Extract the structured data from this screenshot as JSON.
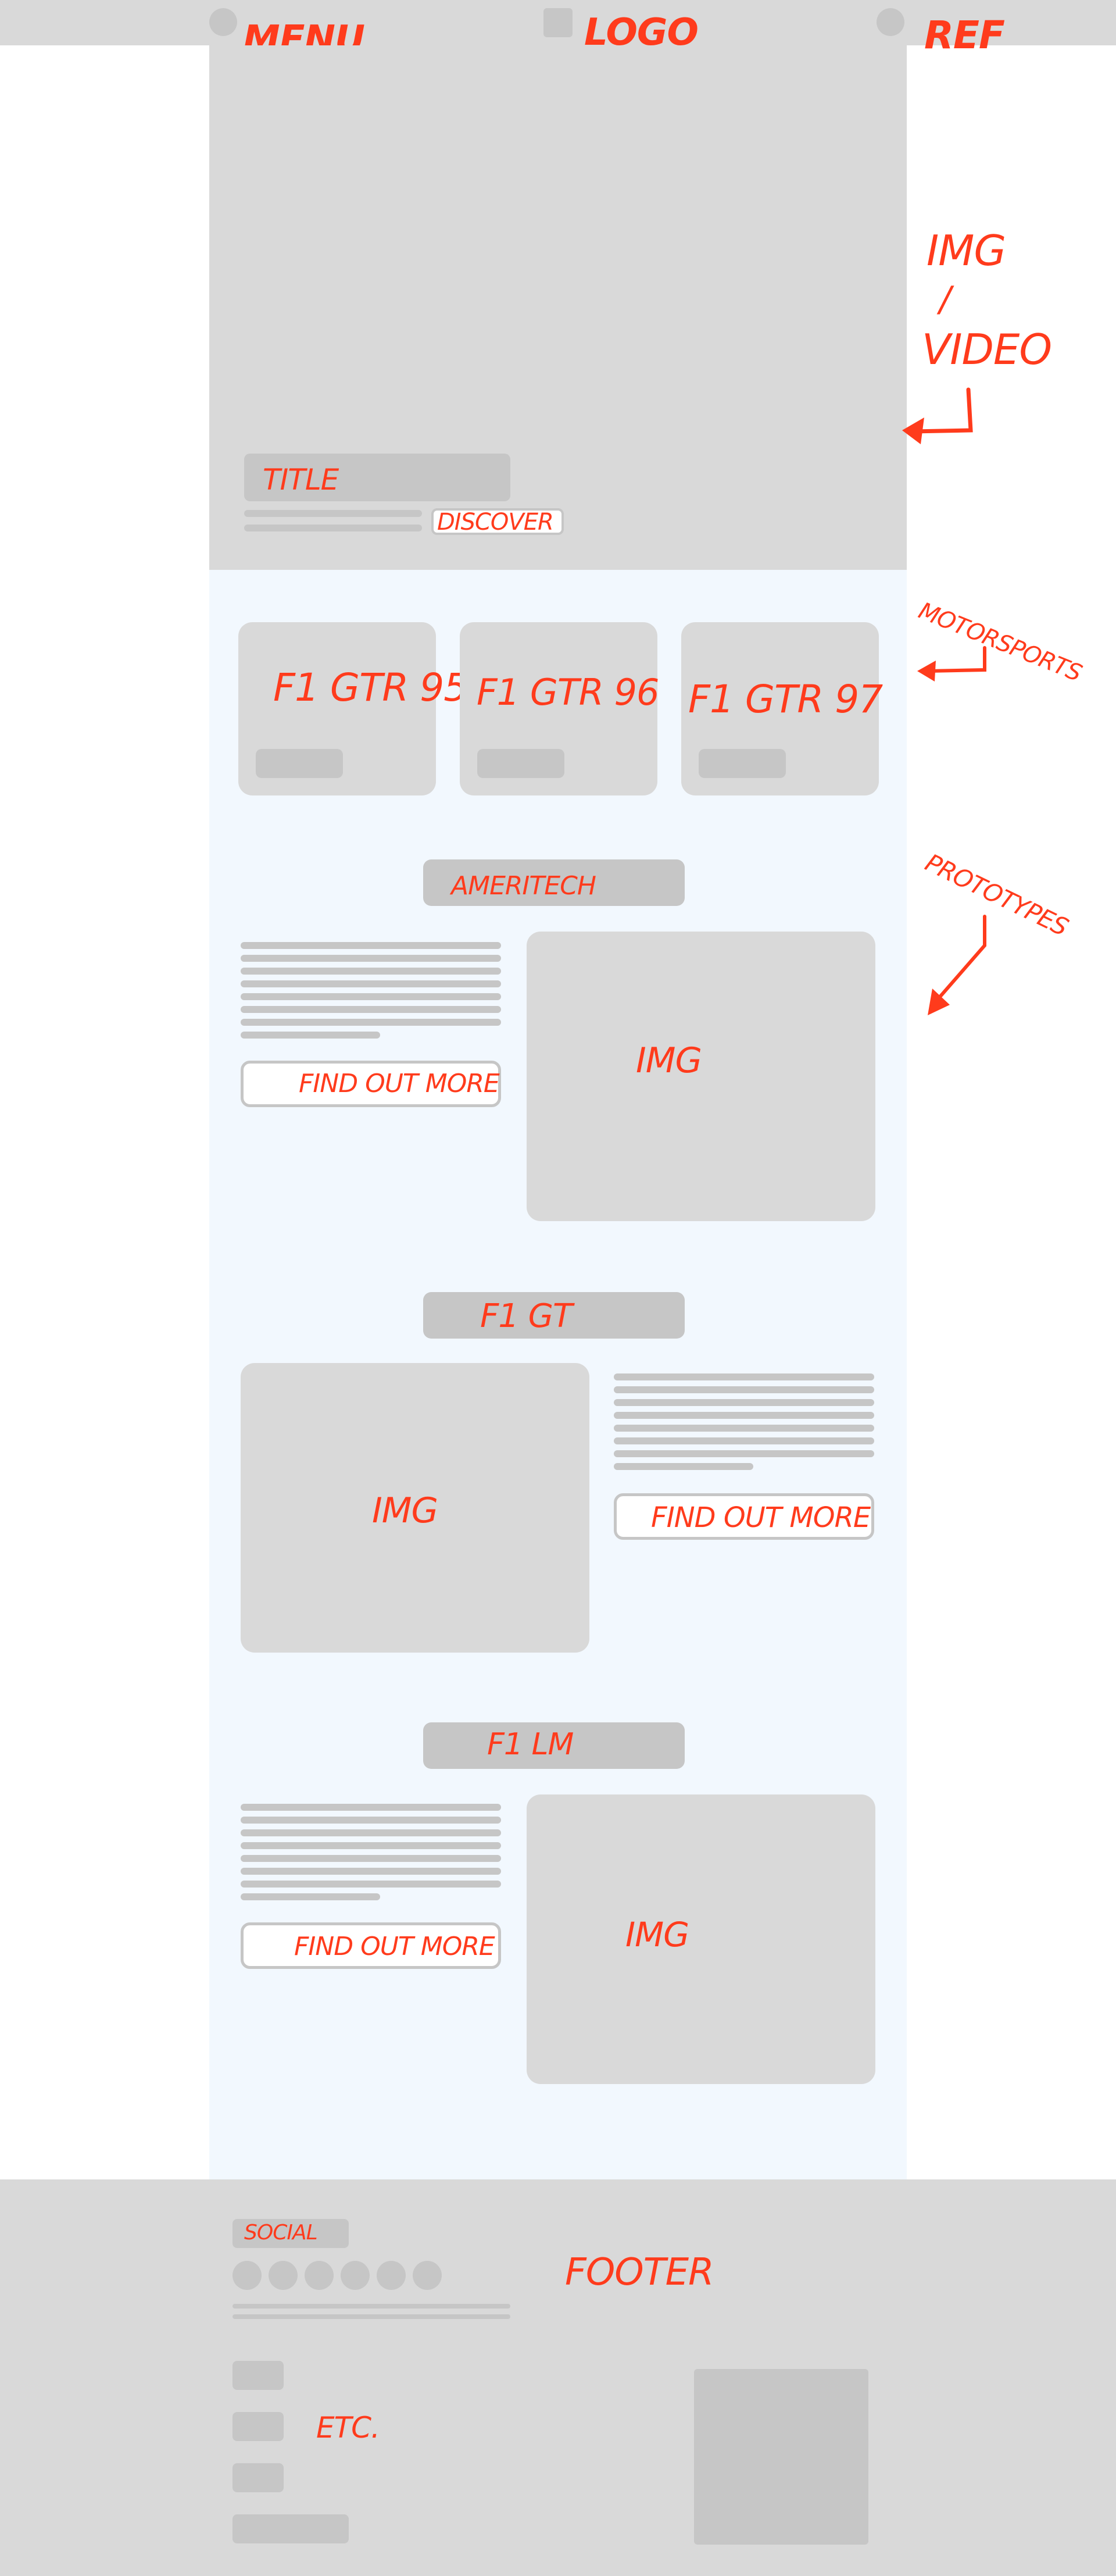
{
  "header": {
    "menu_label": "MENU",
    "logo_label": "LOGO",
    "ref_label": "REF"
  },
  "hero": {
    "title": "TITLE",
    "discover": "DISCOVER"
  },
  "side_notes": {
    "img_video_line1": "IMG",
    "img_video_line2": "/",
    "img_video_line3": "VIDEO",
    "motorsports": "MOTORSPORTS",
    "prototypes": "PROTOTYPES"
  },
  "motorsport_cards": [
    {
      "label": "F1 GTR 95"
    },
    {
      "label": "F1 GTR 96"
    },
    {
      "label": "F1 GTR 97"
    }
  ],
  "sections": [
    {
      "title": "AMERITECH",
      "image": "IMG",
      "button": "FIND OUT MORE"
    },
    {
      "title": "F1 GT",
      "image": "IMG",
      "button": "FIND OUT MORE"
    },
    {
      "title": "F1 LM",
      "image": "IMG",
      "button": "FIND OUT MORE"
    }
  ],
  "footer": {
    "social": "SOCIAL",
    "footer_label": "FOOTER",
    "etc": "ETC."
  },
  "colors": {
    "annotation": "#ff3b1c",
    "placeholder": "#d9d9d9",
    "placeholder_dark": "#c6c6c6",
    "content_bg": "#f2f8fe"
  }
}
